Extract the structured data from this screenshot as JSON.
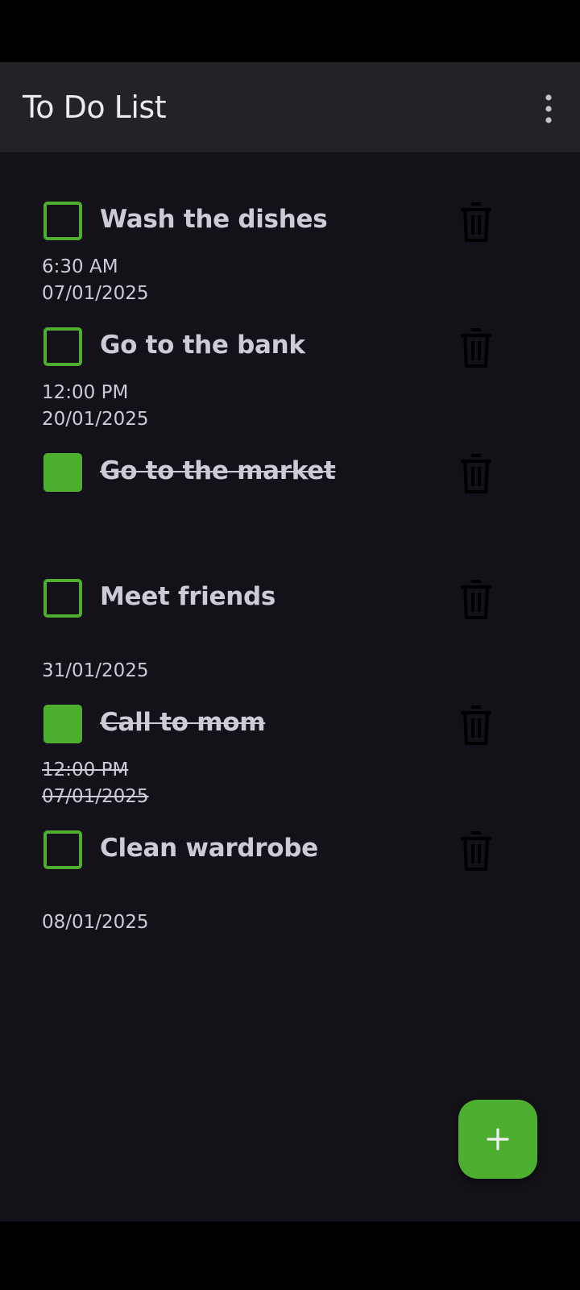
{
  "app_bar": {
    "title": "To Do List",
    "menu_icon": "more-vert-icon"
  },
  "tasks": [
    {
      "title": "Wash the dishes",
      "time": "6:30 AM",
      "date": "07/01/2025",
      "completed": false
    },
    {
      "title": "Go to the bank",
      "time": "12:00 PM",
      "date": "20/01/2025",
      "completed": false
    },
    {
      "title": "Go to the market",
      "time": "",
      "date": "",
      "completed": true
    },
    {
      "title": "Meet friends",
      "time": "",
      "date": "31/01/2025",
      "completed": false
    },
    {
      "title": "Call to mom",
      "time": "12:00 PM",
      "date": "07/01/2025",
      "completed": true
    },
    {
      "title": "Clean wardrobe",
      "time": "",
      "date": "08/01/2025",
      "completed": false
    }
  ],
  "delete_icon": "trash-icon",
  "fab": {
    "icon": "add-icon"
  },
  "colors": {
    "accent": "#4CAF2F",
    "background": "#141218",
    "app_bar": "#222227",
    "text": "#CFCAD8"
  }
}
